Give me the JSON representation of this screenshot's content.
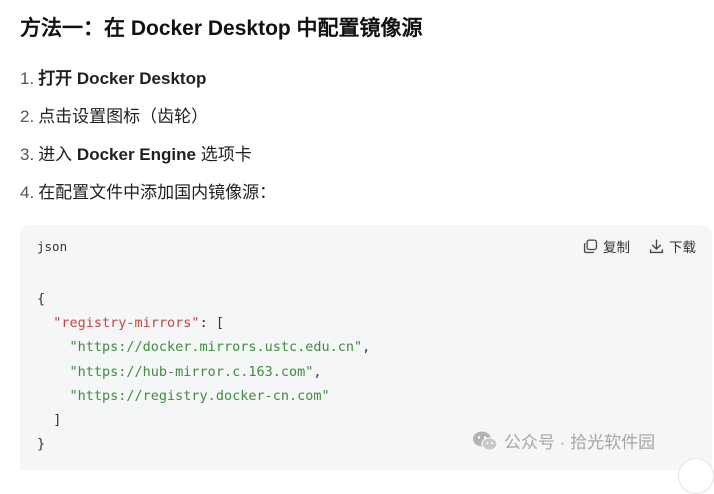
{
  "heading": "方法一：在 Docker Desktop 中配置镜像源",
  "steps": [
    {
      "num": "1.",
      "bold": "打开 Docker Desktop",
      "pre": "",
      "post": ""
    },
    {
      "num": "2.",
      "bold": "",
      "pre": "点击设置图标（齿轮）",
      "post": ""
    },
    {
      "num": "3.",
      "bold": "Docker Engine",
      "pre": "进入 ",
      "post": " 选项卡"
    },
    {
      "num": "4.",
      "bold": "",
      "pre": "在配置文件中添加国内镜像源：",
      "post": ""
    }
  ],
  "code_block": {
    "language": "json",
    "copy_label": "复制",
    "download_label": "下载",
    "lines": {
      "open_brace": "{",
      "key": "\"registry-mirrors\"",
      "key_suffix": ": [",
      "mirror_1": "\"https://docker.mirrors.ustc.edu.cn\"",
      "mirror_2": "\"https://hub-mirror.c.163.com\"",
      "mirror_3": "\"https://registry.docker-cn.com\"",
      "comma": ",",
      "close_bracket": "]",
      "close_brace": "}"
    }
  },
  "watermark": "公众号 · 拾光软件园",
  "colors": {
    "code_background": "#f5f6f8",
    "json_key": "#c8453c",
    "json_string": "#3f8d3a",
    "watermark": "#a6a6a6"
  }
}
